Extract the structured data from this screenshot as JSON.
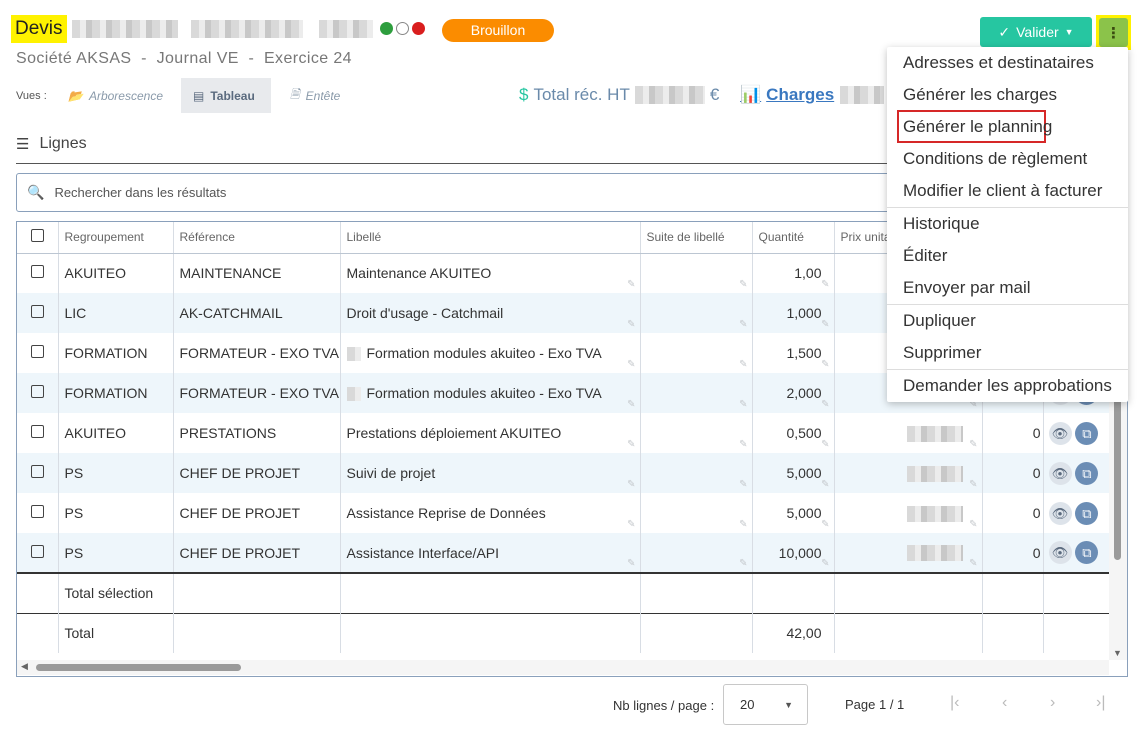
{
  "header": {
    "title": "Devis",
    "status_dots": [
      "#2e9e3e",
      "#ffffff",
      "#d91e1e"
    ],
    "status_badge": "Brouillon",
    "subtitle": "Société AKSAS  -  Journal VE  -  Exercice 24",
    "valider_label": "Valider"
  },
  "views": {
    "label": "Vues :",
    "items": [
      {
        "label": "Arborescence",
        "icon": "folder-icon",
        "active": false
      },
      {
        "label": "Tableau",
        "icon": "table-icon",
        "active": true
      },
      {
        "label": "Entête",
        "icon": "file-settings-icon",
        "active": false
      }
    ]
  },
  "totals": {
    "label": "Total réc. HT",
    "currency": "€",
    "charges_label": "Charges"
  },
  "section": {
    "title": "Lignes"
  },
  "search": {
    "placeholder": "Rechercher dans les résultats"
  },
  "table": {
    "columns": [
      "Regroupement",
      "Référence",
      "Libellé",
      "Suite de libellé",
      "Quantité",
      "Prix unita"
    ],
    "rows": [
      {
        "regroupement": "AKUITEO",
        "reference": "MAINTENANCE",
        "libelle": "Maintenance AKUITEO",
        "suite": "",
        "quantite": "1,00",
        "last": ""
      },
      {
        "regroupement": "LIC",
        "reference": "AK-CATCHMAIL",
        "libelle": "Droit d'usage - Catchmail",
        "suite": "",
        "quantite": "1,000",
        "last": ""
      },
      {
        "regroupement": "FORMATION",
        "reference": "FORMATEUR - EXO TVA",
        "libelle": "Formation modules akuiteo - Exo TVA",
        "suite": "",
        "quantite": "1,500",
        "last": ""
      },
      {
        "regroupement": "FORMATION",
        "reference": "FORMATEUR - EXO TVA",
        "libelle": "Formation modules akuiteo - Exo TVA",
        "suite": "",
        "quantite": "2,000",
        "last": ""
      },
      {
        "regroupement": "AKUITEO",
        "reference": "PRESTATIONS",
        "libelle": "Prestations déploiement AKUITEO",
        "suite": "",
        "quantite": "0,500",
        "last": "0"
      },
      {
        "regroupement": "PS",
        "reference": "CHEF DE PROJET",
        "libelle": "Suivi de projet",
        "suite": "",
        "quantite": "5,000",
        "last": "0"
      },
      {
        "regroupement": "PS",
        "reference": "CHEF DE PROJET",
        "libelle": "Assistance Reprise de Données",
        "suite": "",
        "quantite": "5,000",
        "last": "0"
      },
      {
        "regroupement": "PS",
        "reference": "CHEF DE PROJET",
        "libelle": "Assistance Interface/API",
        "suite": "",
        "quantite": "10,000",
        "last": "0"
      }
    ],
    "footer": {
      "selection_label": "Total sélection",
      "total_label": "Total",
      "total_quantite": "42,00"
    }
  },
  "pagination": {
    "lines_label": "Nb lignes / page :",
    "lines_value": "20",
    "page_label": "Page 1 / 1"
  },
  "menu": {
    "items": [
      "Adresses et destinataires",
      "Générer les charges",
      "Générer le planning",
      "Conditions de règlement",
      "Modifier le client à facturer",
      "Historique",
      "Éditer",
      "Envoyer par mail",
      "Dupliquer",
      "Supprimer",
      "Demander les approbations"
    ]
  }
}
